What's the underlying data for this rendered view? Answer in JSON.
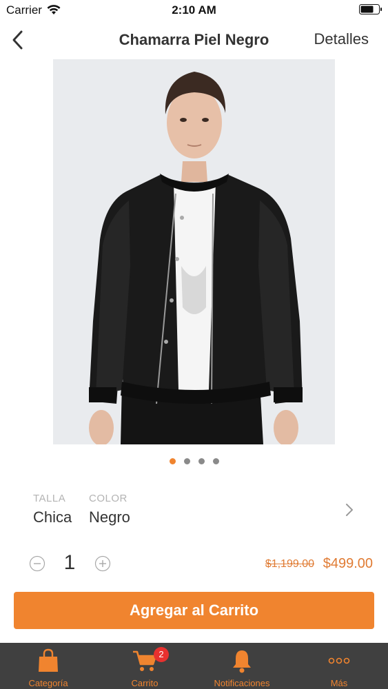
{
  "status_bar": {
    "carrier": "Carrier",
    "time": "2:10 AM"
  },
  "nav": {
    "title": "Chamarra Piel Negro",
    "details_label": "Detalles"
  },
  "carousel": {
    "count": 4,
    "active_index": 0
  },
  "options": {
    "size_label": "TALLA",
    "size_value": "Chica",
    "color_label": "COLOR",
    "color_value": "Negro"
  },
  "quantity": {
    "value": "1"
  },
  "price": {
    "original": "$1,199.00",
    "sale": "$499.00"
  },
  "add_to_cart_label": "Agregar al Carrito",
  "tabs": [
    {
      "label": "Categoría",
      "icon": "shopping-bag-icon"
    },
    {
      "label": "Carrito",
      "icon": "cart-icon",
      "badge": "2"
    },
    {
      "label": "Notificaciones",
      "icon": "bell-icon"
    },
    {
      "label": "Más",
      "icon": "more-icon"
    }
  ],
  "colors": {
    "accent": "#f0842f",
    "tab_bar_bg": "#404040",
    "badge": "#e8312f"
  }
}
